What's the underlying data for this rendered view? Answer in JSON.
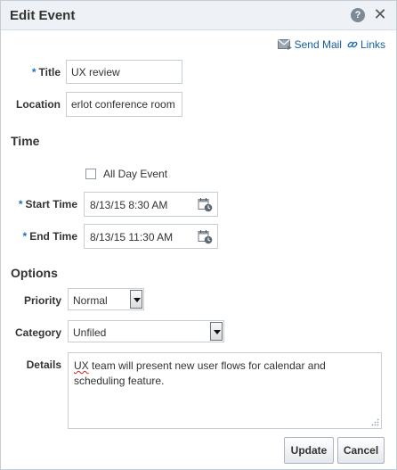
{
  "dialog": {
    "title": "Edit Event",
    "help_glyph": "?",
    "close_glyph": "✕"
  },
  "links": {
    "send_mail": "Send Mail",
    "links": "Links"
  },
  "form": {
    "required_marker": "*",
    "title_label": "Title",
    "title_value": "UX review",
    "location_label": "Location",
    "location_value": "erlot conference room",
    "time_section": "Time",
    "all_day_label": "All Day Event",
    "all_day_checked": false,
    "start_label": "Start Time",
    "start_value": "8/13/15 8:30 AM",
    "end_label": "End Time",
    "end_value": "8/13/15 11:30 AM",
    "options_section": "Options",
    "priority_label": "Priority",
    "priority_value": "Normal",
    "category_label": "Category",
    "category_value": "Unfiled",
    "details_label": "Details",
    "details_misspelled": "UX",
    "details_rest": " team will present new user flows for calendar and scheduling feature."
  },
  "buttons": {
    "update": "Update",
    "cancel": "Cancel"
  },
  "icons": {
    "help": "help-icon",
    "close": "close-icon",
    "mail": "envelope-icon",
    "link": "chain-link-icon",
    "calendar": "calendar-clock-icon"
  },
  "colors": {
    "titlebar_bg": "#eef2f6",
    "link": "#145c9e",
    "required": "#1a6fc6",
    "border": "#c5ced6"
  }
}
